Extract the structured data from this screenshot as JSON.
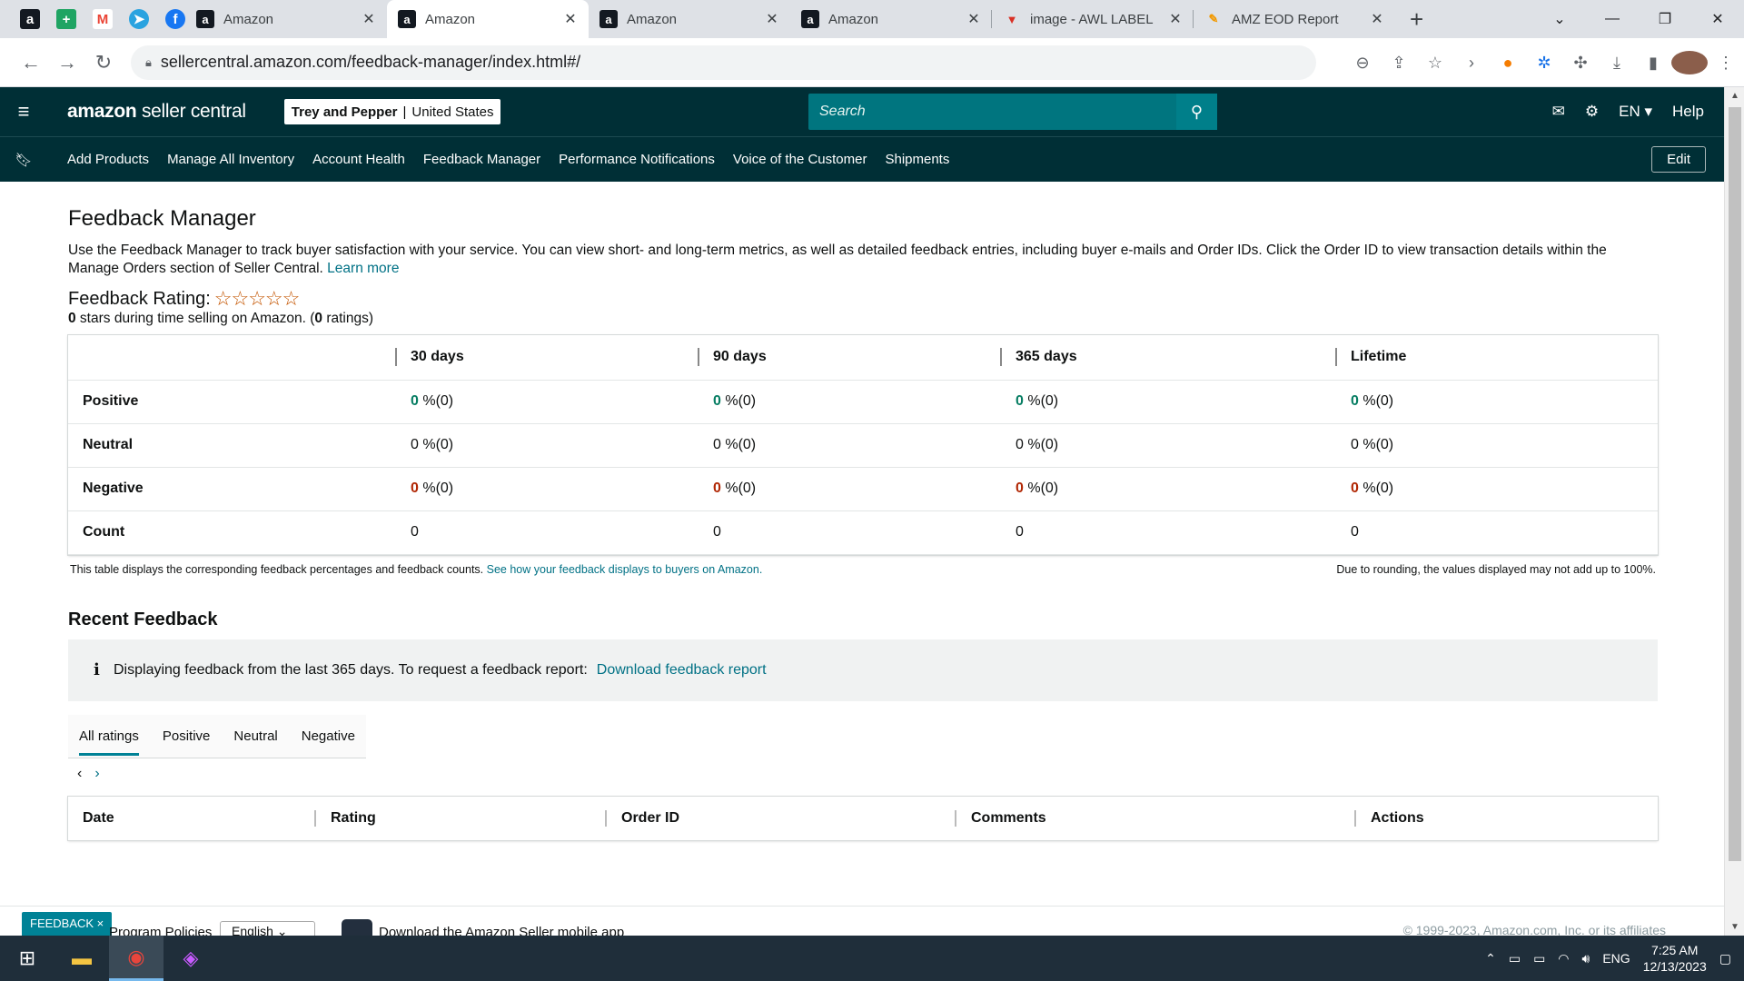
{
  "browser": {
    "tabs": [
      {
        "title": "Amazon",
        "active": false
      },
      {
        "title": "Amazon",
        "active": true
      },
      {
        "title": "Amazon",
        "active": false
      },
      {
        "title": "Amazon",
        "active": false
      },
      {
        "title": "image - AWL LABEL",
        "active": false
      },
      {
        "title": "AMZ EOD Report",
        "active": false
      }
    ],
    "url": "sellercentral.amazon.com/feedback-manager/index.html#/"
  },
  "header": {
    "logo_brand": "amazon",
    "logo_suffix": "seller central",
    "store_name": "Trey and Pepper",
    "store_region": "United States",
    "search_placeholder": "Search",
    "lang": "EN ▾",
    "help": "Help"
  },
  "nav": {
    "items": [
      "Add Products",
      "Manage All Inventory",
      "Account Health",
      "Feedback Manager",
      "Performance Notifications",
      "Voice of the Customer",
      "Shipments"
    ],
    "edit": "Edit"
  },
  "page": {
    "title": "Feedback Manager",
    "intro": "Use the Feedback Manager to track buyer satisfaction with your service. You can view short- and long-term metrics, as well as detailed feedback entries, including buyer e-mails and Order IDs. Click the Order ID to view transaction details within the Manage Orders section of Seller Central.",
    "learn_more": "Learn more",
    "rating_label": "Feedback Rating:",
    "stars": "☆☆☆☆☆",
    "rating_stars_value": "0",
    "rating_text_mid": " stars during time selling on Amazon. (",
    "rating_count": "0",
    "rating_text_end": " ratings)"
  },
  "metrics": {
    "columns": [
      "30 days",
      "90 days",
      "365 days",
      "Lifetime"
    ],
    "rows": [
      {
        "label": "Positive",
        "cells": [
          {
            "n": "0",
            "p": " %(0)"
          },
          {
            "n": "0",
            "p": " %(0)"
          },
          {
            "n": "0",
            "p": " %(0)"
          },
          {
            "n": "0",
            "p": " %(0)"
          }
        ]
      },
      {
        "label": "Neutral",
        "cells": [
          {
            "n": "0",
            "p": " %(0)"
          },
          {
            "n": "0",
            "p": " %(0)"
          },
          {
            "n": "0",
            "p": " %(0)"
          },
          {
            "n": "0",
            "p": " %(0)"
          }
        ]
      },
      {
        "label": "Negative",
        "cells": [
          {
            "n": "0",
            "p": " %(0)"
          },
          {
            "n": "0",
            "p": " %(0)"
          },
          {
            "n": "0",
            "p": " %(0)"
          },
          {
            "n": "0",
            "p": " %(0)"
          }
        ]
      },
      {
        "label": "Count",
        "cells": [
          {
            "n": "0",
            "p": ""
          },
          {
            "n": "0",
            "p": ""
          },
          {
            "n": "0",
            "p": ""
          },
          {
            "n": "0",
            "p": ""
          }
        ]
      }
    ],
    "note_left": "This table displays the corresponding feedback percentages and feedback counts.",
    "note_link": "See how your feedback displays to buyers on Amazon.",
    "note_right": "Due to rounding, the values displayed may not add up to 100%."
  },
  "recent": {
    "title": "Recent Feedback",
    "info_text": "Displaying feedback from the last 365 days. To request a feedback report:",
    "info_link": "Download feedback report",
    "tabs": [
      "All ratings",
      "Positive",
      "Neutral",
      "Negative"
    ],
    "columns": [
      "Date",
      "Rating",
      "Order ID",
      "Comments",
      "Actions"
    ]
  },
  "footer": {
    "feedback_badge": "FEEDBACK ×",
    "program_policies": "Program Policies",
    "language": "English",
    "app_text": "Download the Amazon Seller mobile app",
    "copyright": "© 1999-2023, Amazon.com, Inc. or its affiliates"
  },
  "taskbar": {
    "lang": "ENG",
    "time": "7:25 AM",
    "date": "12/13/2023"
  },
  "colors": {
    "header_bg": "#002f36",
    "search_bg": "#00757f",
    "positive": "#067d62",
    "negative": "#b12704",
    "link": "#007185"
  }
}
